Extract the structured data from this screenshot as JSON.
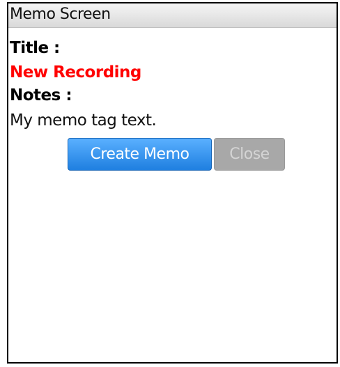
{
  "screen": {
    "title": "Memo Screen"
  },
  "form": {
    "title_label": "Title :",
    "title_value": "New Recording",
    "notes_label": "Notes :",
    "notes_value": "My memo tag text."
  },
  "buttons": {
    "create_label": "Create Memo",
    "close_label": "Close"
  },
  "colors": {
    "title_value": "#ff0000",
    "primary_button": "#2a86e8",
    "disabled_button": "#a8a8a8"
  }
}
